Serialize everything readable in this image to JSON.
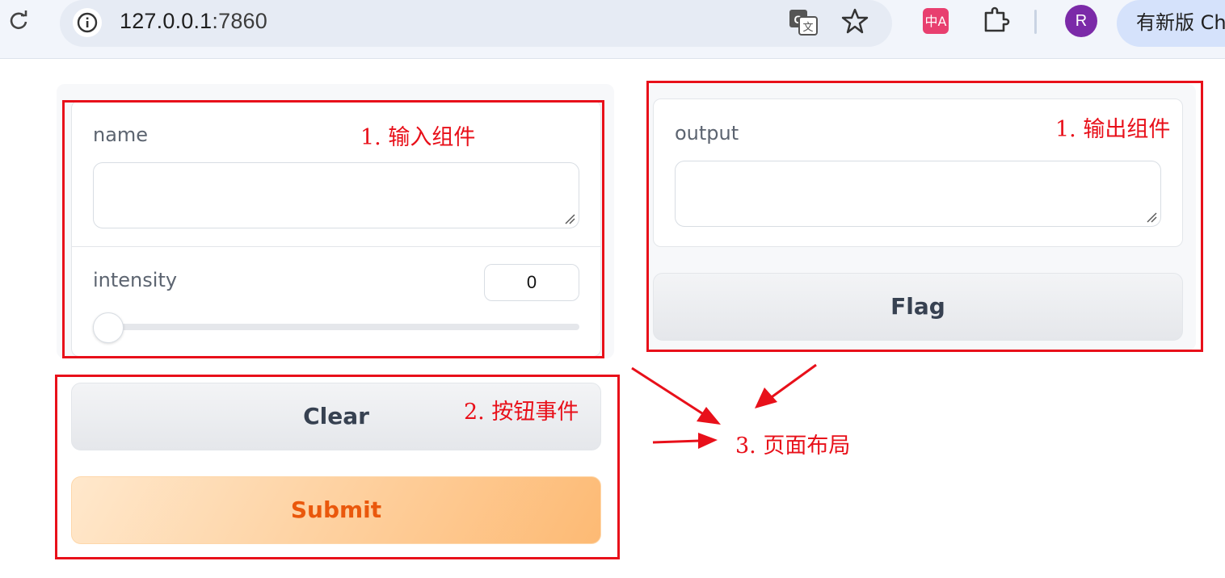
{
  "browser": {
    "url_host": "127.0.0.1",
    "url_port": ":7860",
    "profile_initial": "R",
    "update_chip_text": "有新版 Chrome",
    "icons": [
      "reload-icon",
      "info-icon",
      "translate-icon",
      "star-icon",
      "chinese-ext-icon",
      "puzzle-icon"
    ]
  },
  "inputs": {
    "name_label": "name",
    "name_value": "",
    "intensity_label": "intensity",
    "intensity_value": "0",
    "intensity_level": 0
  },
  "outputs": {
    "output_label": "output",
    "output_value": ""
  },
  "buttons": {
    "flag": "Flag",
    "clear": "Clear",
    "submit": "Submit"
  },
  "annotations": {
    "input_components": "1. 输入组件",
    "output_components": "1. 输出组件",
    "button_events": "2. 按钮事件",
    "page_layout": "3. 页面布局",
    "color": "#e8101a"
  },
  "theme": {
    "primary_text": "#ea580c",
    "primary_bg": "#fdba74",
    "secondary_text": "#374151"
  }
}
